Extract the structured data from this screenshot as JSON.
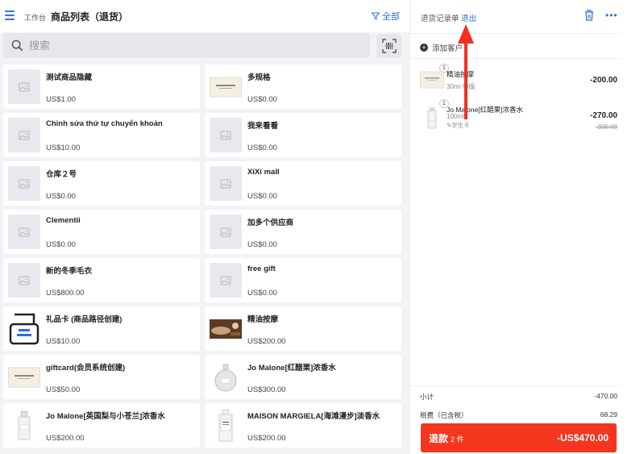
{
  "header": {
    "breadcrumb": "工作台",
    "title": "商品列表（退货）",
    "filter_label": "全部"
  },
  "search": {
    "placeholder": "搜索"
  },
  "products": [
    {
      "name": "测试商品隐藏",
      "price": "US$1.00",
      "image": "placeholder"
    },
    {
      "name": "多规格",
      "price": "US$0.00",
      "image": "jo-malone-box"
    },
    {
      "name": "Chỉnh sửa thứ tự chuyển khoản",
      "price": "US$10.00",
      "image": "placeholder"
    },
    {
      "name": "我来看看",
      "price": "US$0.00",
      "image": "placeholder"
    },
    {
      "name": "仓库２号",
      "price": "US$0.00",
      "image": "placeholder"
    },
    {
      "name": "XiXi mall",
      "price": "US$0.00",
      "image": "placeholder"
    },
    {
      "name": "Clementii",
      "price": "US$0.00",
      "image": "placeholder"
    },
    {
      "name": "加多个供应商",
      "price": "US$0.00",
      "image": "placeholder"
    },
    {
      "name": "新的冬季毛衣",
      "price": "US$800.00",
      "image": "placeholder"
    },
    {
      "name": "free gift",
      "price": "US$0.00",
      "image": "placeholder"
    },
    {
      "name": "礼品卡 (商品路径创建)",
      "price": "US$10.00",
      "image": "gift-card-icon"
    },
    {
      "name": "精油按摩",
      "price": "US$200.00",
      "image": "massage-photo"
    },
    {
      "name": "giftcard(会员系统创建)",
      "price": "US$50.00",
      "image": "jo-malone-box"
    },
    {
      "name": "Jo Malone[红醋栗]浓香水",
      "price": "US$300.00",
      "image": "perfume-round"
    },
    {
      "name": "Jo Malone[英国梨与小苍兰]浓香水",
      "price": "US$200.00",
      "image": "perfume-bottle"
    },
    {
      "name": "MAISON MARGIELA[海滩漫步]淡香水",
      "price": "US$200.00",
      "image": "perfume-tall"
    }
  ],
  "panel": {
    "title": "退货记录单",
    "exit_label": "退出",
    "add_customer": "添加客户",
    "lines": [
      {
        "qty": "1",
        "name": "精油按摩",
        "sub": "30mi",
        "sub_extra": "中级",
        "price": "-200.00",
        "orig": "",
        "tag": ""
      },
      {
        "qty": "1",
        "name": "Jo Malone[红醋栗]浓香水",
        "sub": "100ml",
        "sub_extra": "",
        "tag": "学生卡",
        "price": "-270.00",
        "orig": "-300.00"
      }
    ],
    "subtotal_label": "小计",
    "subtotal_value": "-470.00",
    "tax_label": "税费（已含税）",
    "tax_value": "68.29",
    "refund_label": "退款",
    "refund_count": "2 件",
    "refund_total": "-US$470.00"
  },
  "colors": {
    "accent": "#2d6cdf",
    "refund": "#f3361d",
    "arrow": "#f03020"
  }
}
